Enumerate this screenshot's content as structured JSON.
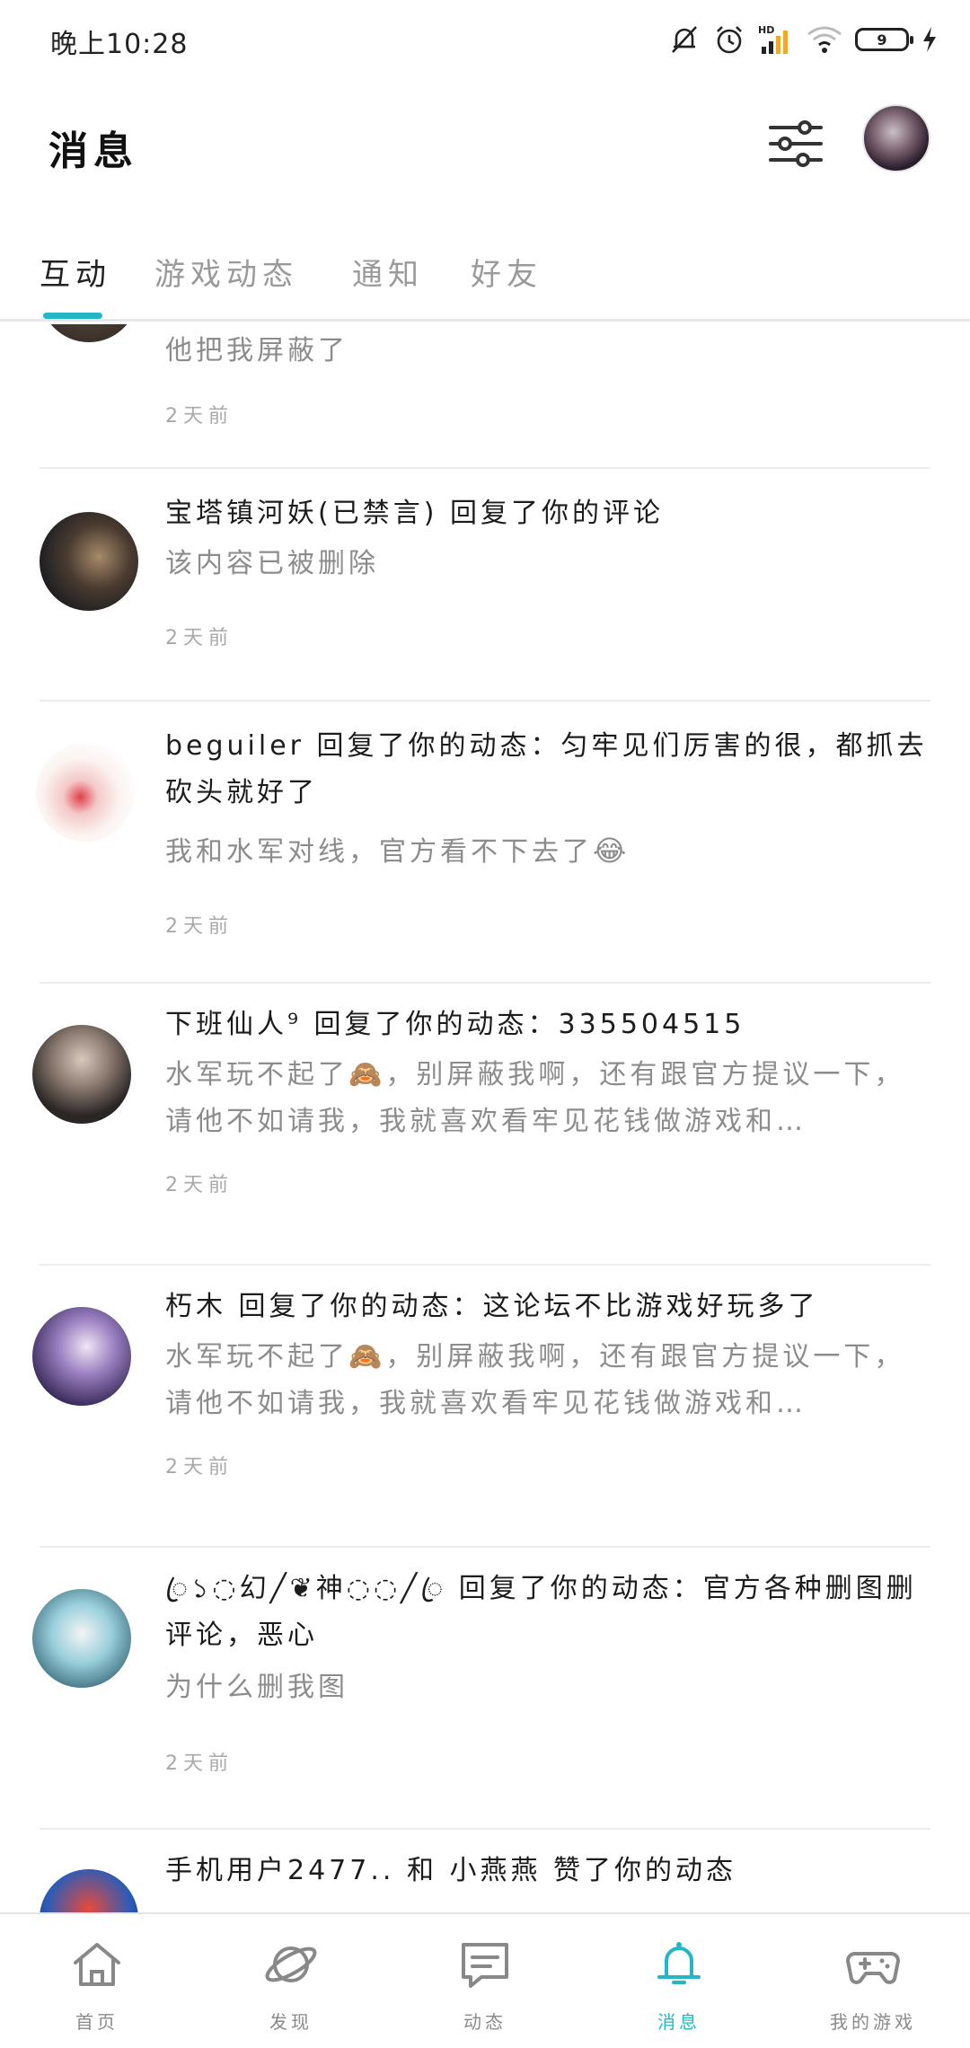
{
  "status_bar": {
    "time": "晚上10:28",
    "battery": "9",
    "network": "HD"
  },
  "header": {
    "title": "消息"
  },
  "tabs": [
    {
      "label": "互动",
      "active": true
    },
    {
      "label": "游戏动态",
      "active": false
    },
    {
      "label": "通知",
      "active": false
    },
    {
      "label": "好友",
      "active": false
    }
  ],
  "accent_color": "#24b6c6",
  "messages": [
    {
      "title": "",
      "body": "他把我屏蔽了",
      "time": "2天前"
    },
    {
      "title": "宝塔镇河妖(已禁言) 回复了你的评论",
      "body": "该内容已被删除",
      "time": "2天前"
    },
    {
      "title": "beguiler 回复了你的动态：匀牢见们厉害的很，都抓去砍头就好了",
      "body": "我和水军对线，官方看不下去了",
      "body_emoji": "😂",
      "time": "2天前"
    },
    {
      "title": "下班仙人⁹ 回复了你的动态：335504515",
      "body": "水军玩不起了🙈，别屏蔽我啊，还有跟官方提议一下，请他不如请我，我就喜欢看牢见花钱做游戏和…",
      "time": "2天前"
    },
    {
      "title": "朽木 回复了你的动态：这论坛不比游戏好玩多了",
      "body": "水军玩不起了🙈，别屏蔽我啊，还有跟官方提议一下，请他不如请我，我就喜欢看牢见花钱做游戏和…",
      "time": "2天前"
    },
    {
      "title": "ꦿ১◌幻╱❦神◌◌╱ꦿ 回复了你的动态：官方各种删图删评论，恶心",
      "body": "为什么删我图",
      "time": "2天前"
    },
    {
      "title": "手机用户2477.. 和 小燕燕 赞了你的动态",
      "body": "",
      "time": ""
    }
  ],
  "bottom_nav": [
    {
      "label": "首页",
      "icon": "home-icon",
      "active": false
    },
    {
      "label": "发现",
      "icon": "planet-icon",
      "active": false
    },
    {
      "label": "动态",
      "icon": "chat-icon",
      "active": false
    },
    {
      "label": "消息",
      "icon": "bell-icon",
      "active": true
    },
    {
      "label": "我的游戏",
      "icon": "gamepad-icon",
      "active": false
    }
  ]
}
